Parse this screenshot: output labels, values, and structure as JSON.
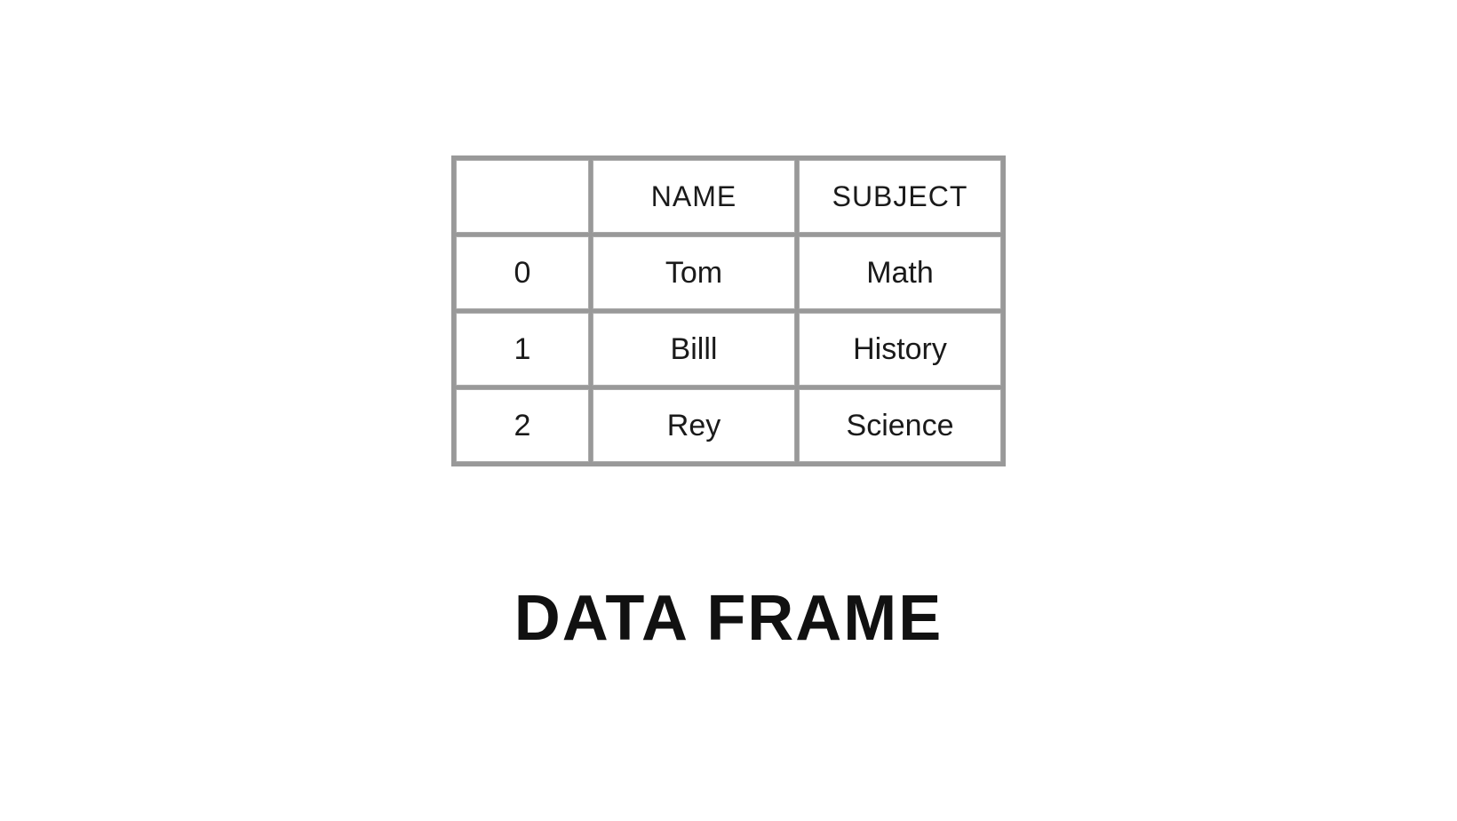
{
  "table": {
    "headers": {
      "index": "",
      "name": "NAME",
      "subject": "SUBJECT"
    },
    "rows": [
      {
        "index": "0",
        "name": "Tom",
        "subject": "Math"
      },
      {
        "index": "1",
        "name": "Billl",
        "subject": "History"
      },
      {
        "index": "2",
        "name": "Rey",
        "subject": "Science"
      }
    ]
  },
  "title": "DATA FRAME"
}
